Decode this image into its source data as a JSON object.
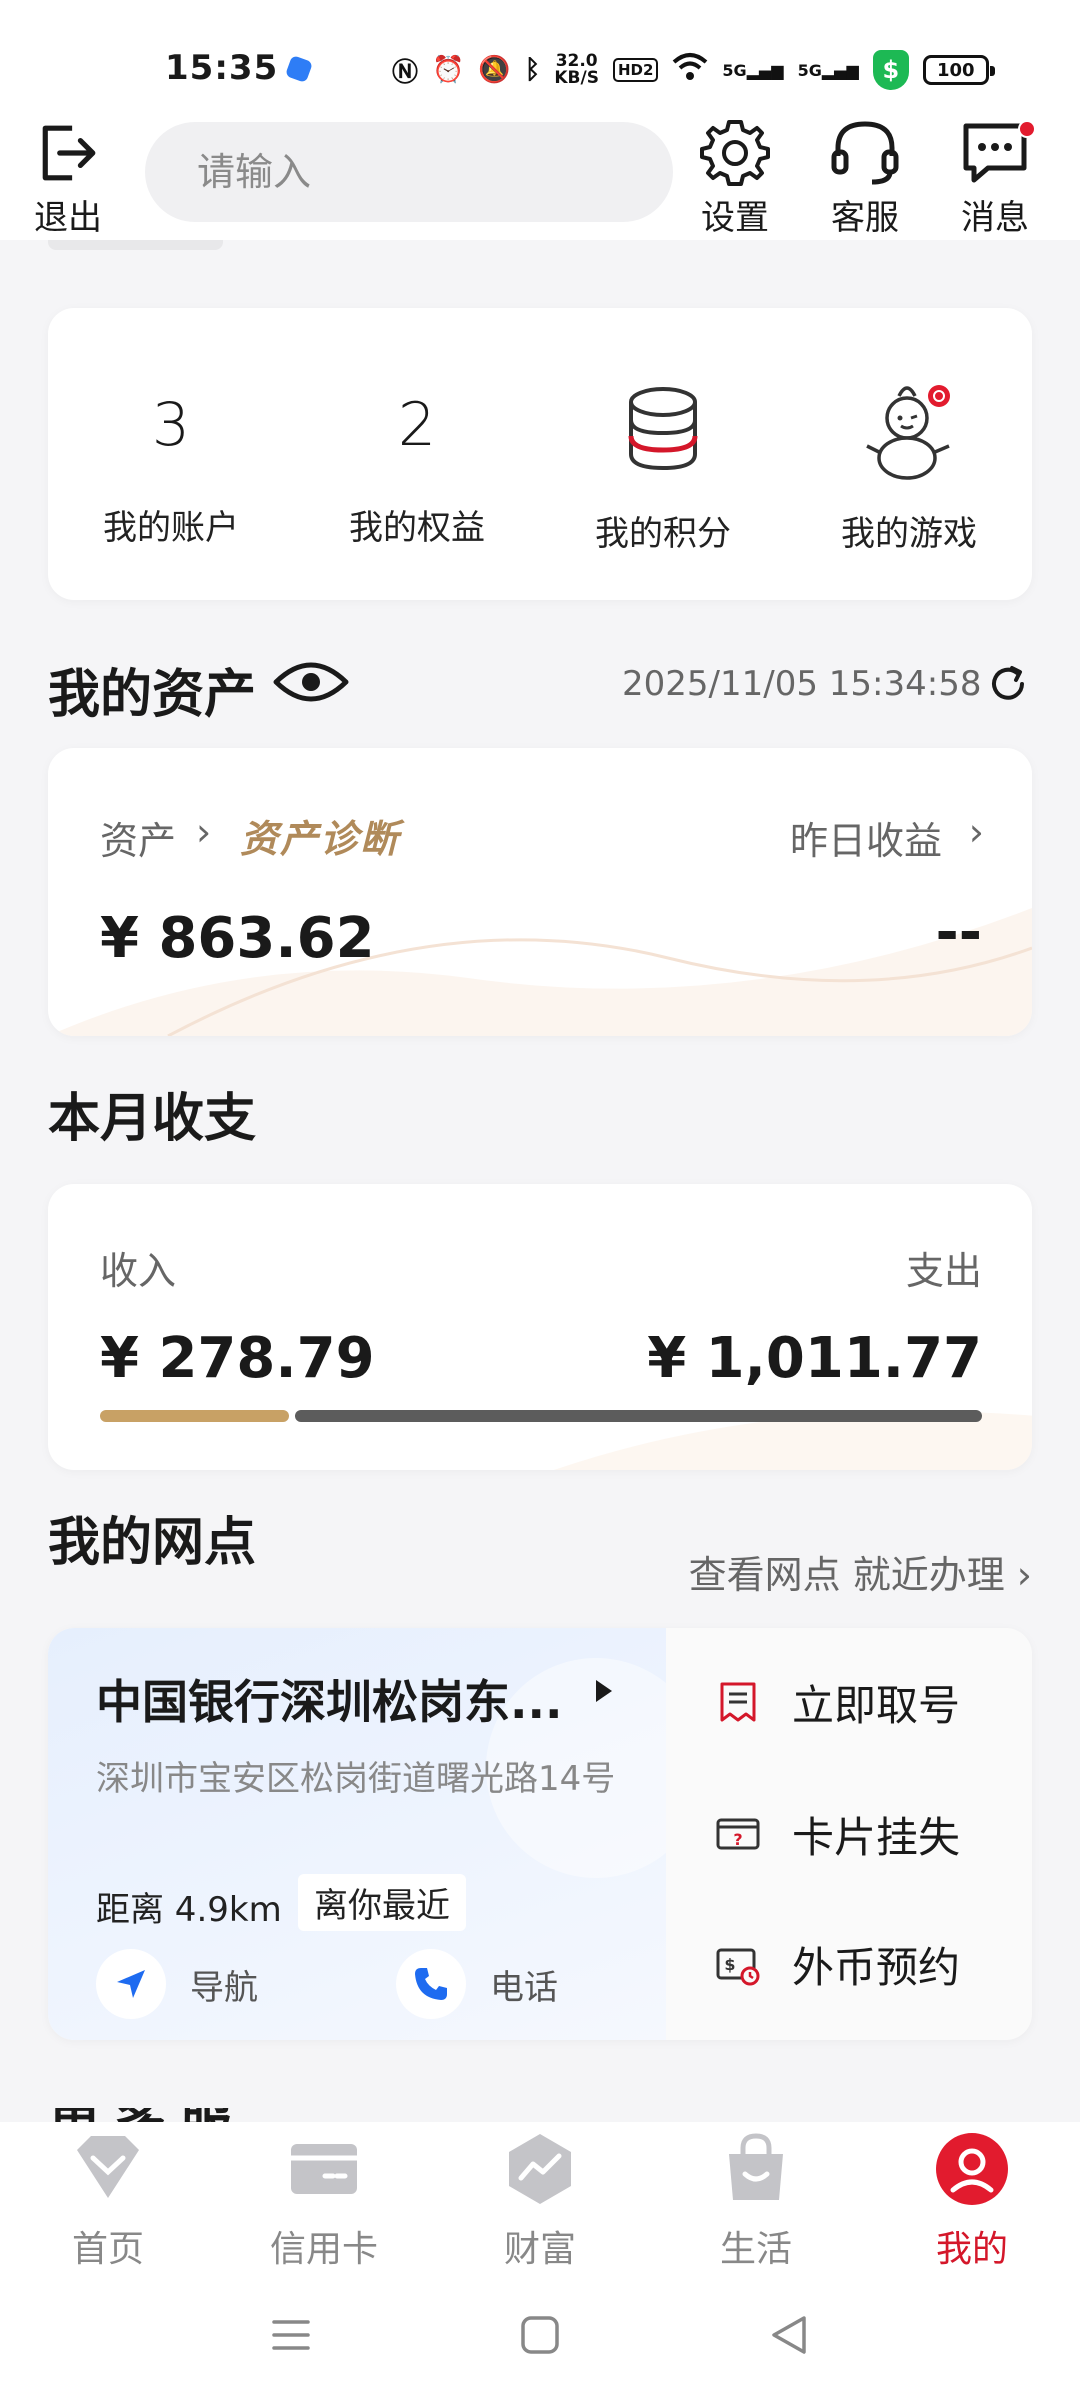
{
  "status_bar": {
    "time": "15:35",
    "net_speed_value": "32.0",
    "net_speed_unit": "KB/S",
    "hd_label": "HD2",
    "signal1": "5G",
    "signal2": "5G",
    "battery": "100"
  },
  "header": {
    "exit_label": "退出",
    "search_placeholder": "请输入",
    "settings_label": "设置",
    "service_label": "客服",
    "messages_label": "消息"
  },
  "quick_links": [
    {
      "value": "3",
      "label": "我的账户"
    },
    {
      "value": "2",
      "label": "我的权益"
    },
    {
      "icon": "coins-stack-icon",
      "label": "我的积分"
    },
    {
      "icon": "snowman-mascot-icon",
      "label": "我的游戏"
    }
  ],
  "assets": {
    "title": "我的资产",
    "timestamp": "2025/11/05 15:34:58",
    "asset_label": "资产",
    "diagnosis_label": "资产诊断",
    "amount": "¥ 863.62",
    "yesterday_label": "昨日收益",
    "yesterday_value": "--"
  },
  "monthly": {
    "title": "本月收支",
    "income_label": "收入",
    "income_amount": "¥ 278.79",
    "expense_label": "支出",
    "expense_amount": "¥ 1,011.77",
    "income_value": 278.79,
    "expense_value": 1011.77
  },
  "branch": {
    "title": "我的网点",
    "link": "查看网点 就近办理",
    "name": "中国银行深圳松岗东...",
    "address": "深圳市宝安区松岗街道曙光路14号",
    "distance": "距离 4.9km",
    "nearest_tag": "离你最近",
    "navigate_label": "导航",
    "phone_label": "电话",
    "services": [
      "立即取号",
      "卡片挂失",
      "外币预约"
    ]
  },
  "more_section_peek": "更多服务",
  "bottom_nav": [
    {
      "label": "首页",
      "icon": "home-diamond-icon"
    },
    {
      "label": "信用卡",
      "icon": "credit-card-icon"
    },
    {
      "label": "财富",
      "icon": "wealth-chart-icon"
    },
    {
      "label": "生活",
      "icon": "shopping-bag-icon"
    },
    {
      "label": "我的",
      "icon": "profile-icon",
      "active": true
    }
  ],
  "colors": {
    "brand_red": "#d4172a",
    "income_gold": "#c8a165",
    "expense_gray": "#5c5c5c",
    "diagnosis_gold": "#b08a5a"
  }
}
